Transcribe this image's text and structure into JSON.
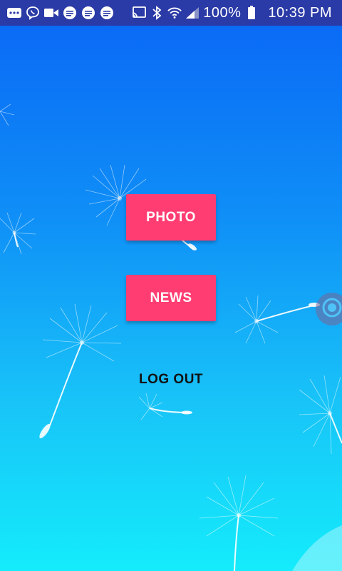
{
  "status_bar": {
    "battery_percent": "100%",
    "time": "10:39 PM",
    "icons": [
      "more-icon",
      "viber-icon",
      "video-icon",
      "message-icon",
      "message-icon",
      "message-icon",
      "cast-icon",
      "bluetooth-icon",
      "wifi-icon",
      "signal-icon",
      "battery-icon"
    ]
  },
  "menu": {
    "photo_label": "PHOTO",
    "news_label": "NEWS",
    "logout_label": "LOG OUT"
  },
  "colors": {
    "status_bar": "#2a3aa6",
    "button": "#ff3d72",
    "background_top": "#0a66f5",
    "background_bottom": "#14ecfb"
  },
  "floating_widget_icon": "target-icon"
}
